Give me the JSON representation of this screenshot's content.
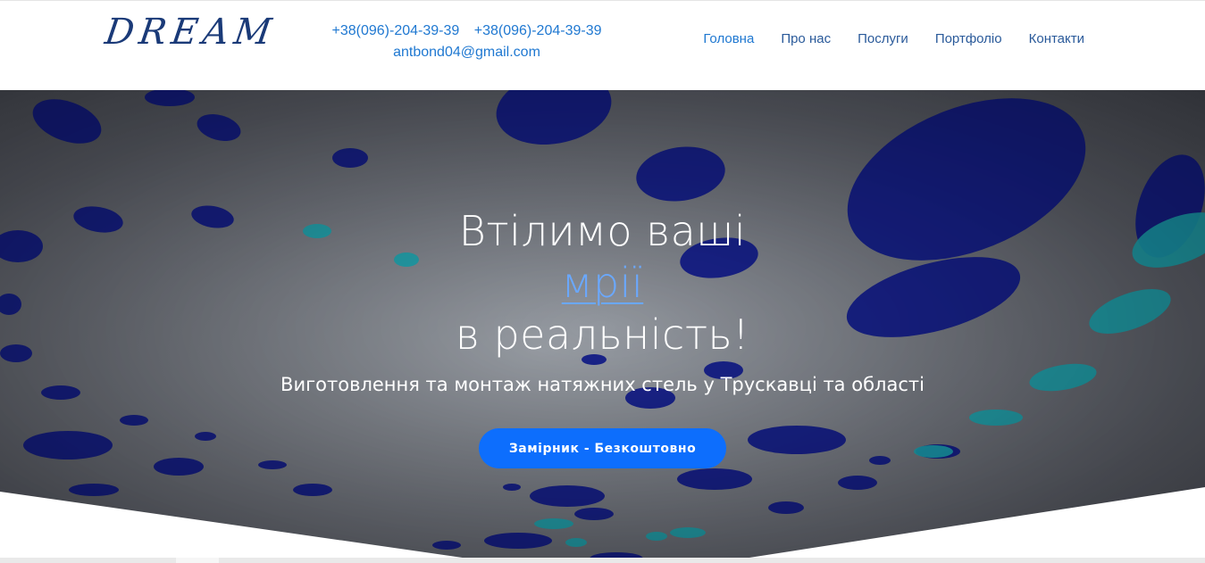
{
  "header": {
    "logo_text": "DREAM",
    "phone_1": "+38(096)-204-39-39",
    "phone_2": "+38(096)-204-39-39",
    "email": "antbond04@gmail.com",
    "nav": [
      {
        "label": "Головна"
      },
      {
        "label": "Про нас"
      },
      {
        "label": "Послуги"
      },
      {
        "label": "Портфоліо"
      },
      {
        "label": "Контакти"
      }
    ]
  },
  "hero": {
    "title_line_1": "Втілимо ваші",
    "title_accent": "мрії",
    "title_line_3": "в реальність!",
    "subtitle": "Виготовлення та монтаж натяжних стель у Трускавці та області",
    "cta_label": "Замірник - Безкоштовно"
  },
  "colors": {
    "accent": "#0d6efd",
    "link": "#1f78d1",
    "title_accent": "#6aa8ff",
    "logo": "#1a3a78"
  }
}
